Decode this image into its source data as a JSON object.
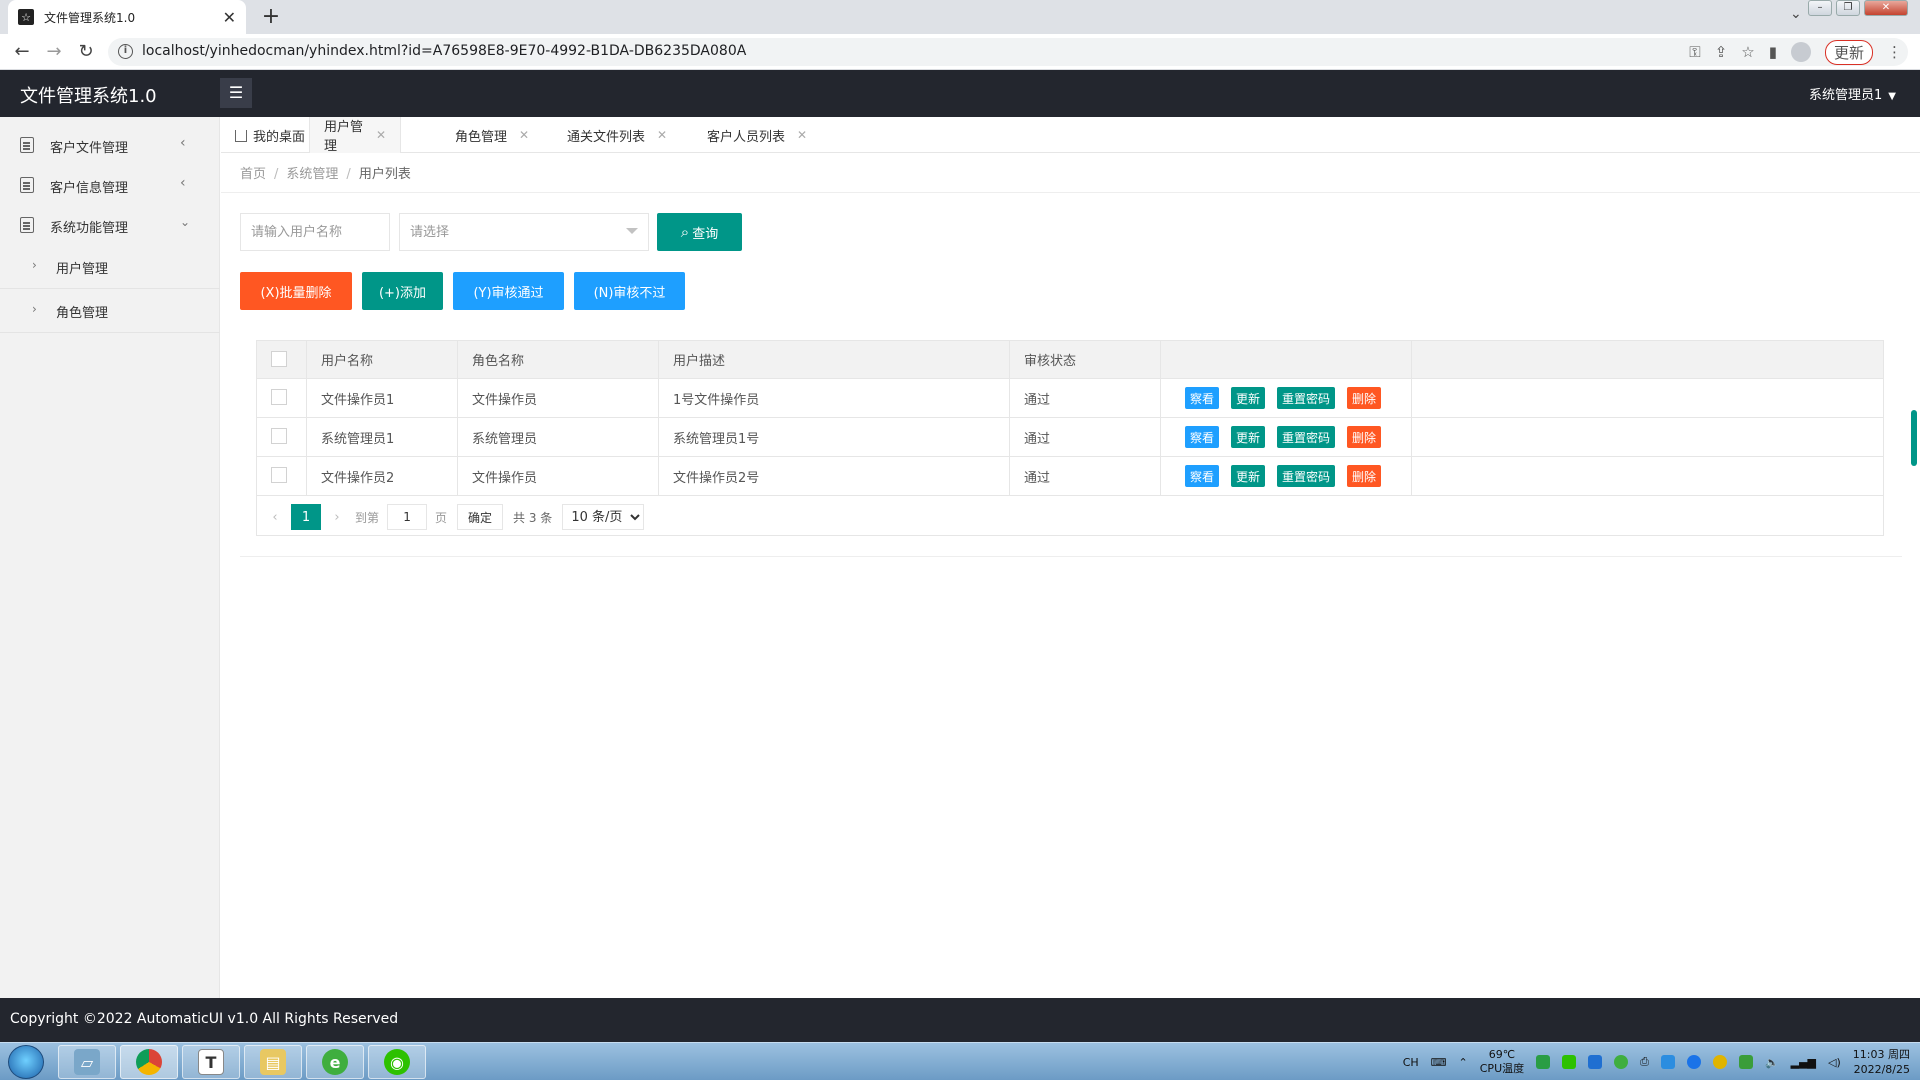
{
  "browser": {
    "tab_title": "文件管理系统1.0",
    "tab_close": "✕",
    "new_tab": "+",
    "url": "localhost/yinhedocman/yhindex.html?id=A76598E8-9E70-4992-B1DA-DB6235DA080A",
    "update_label": "更新"
  },
  "app": {
    "logo": "文件管理系统1.0",
    "user": "系统管理员1"
  },
  "sidebar": {
    "items": [
      {
        "label": "客户文件管理"
      },
      {
        "label": "客户信息管理"
      },
      {
        "label": "系统功能管理"
      }
    ],
    "sub_items": [
      {
        "label": "用户管理"
      },
      {
        "label": "角色管理"
      }
    ]
  },
  "page_tabs": [
    {
      "label": "我的桌面"
    },
    {
      "label": "用户管理"
    },
    {
      "label": "角色管理"
    },
    {
      "label": "通关文件列表"
    },
    {
      "label": "客户人员列表"
    }
  ],
  "breadcrumb": {
    "home": "首页",
    "section": "系统管理",
    "current": "用户列表",
    "sep": "/"
  },
  "search": {
    "username_placeholder": "请输入用户名称",
    "select_placeholder": "请选择",
    "query_label": "查询"
  },
  "actions": {
    "batch_delete": "(X)批量删除",
    "add": "(+)添加",
    "approve": "(Y)审核通过",
    "reject": "(N)审核不过"
  },
  "table": {
    "headers": [
      "用户名称",
      "角色名称",
      "用户描述",
      "审核状态"
    ],
    "rows": [
      {
        "username": "文件操作员1",
        "role": "文件操作员",
        "desc": "1号文件操作员",
        "status": "通过"
      },
      {
        "username": "系统管理员1",
        "role": "系统管理员",
        "desc": "系统管理员1号",
        "status": "通过"
      },
      {
        "username": "文件操作员2",
        "role": "文件操作员",
        "desc": "文件操作员2号",
        "status": "通过"
      }
    ],
    "row_actions": {
      "view": "察看",
      "update": "更新",
      "reset_pwd": "重置密码",
      "delete": "删除"
    }
  },
  "pager": {
    "current_page": "1",
    "goto_label": "到第",
    "goto_value": "1",
    "page_suffix": "页",
    "confirm": "确定",
    "total": "共 3 条",
    "page_size": "10 条/页"
  },
  "footer": {
    "text": "Copyright ©2022 AutomaticUI v1.0 All Rights Reserved"
  },
  "taskbar": {
    "lang": "CH",
    "temp": "69℃",
    "temp_label": "CPU温度",
    "time": "11:03 周四",
    "date": "2022/8/25"
  },
  "colors": {
    "primary": "#009688",
    "danger": "#ff5722",
    "info": "#1e9fff",
    "header_bg": "#23262e"
  }
}
